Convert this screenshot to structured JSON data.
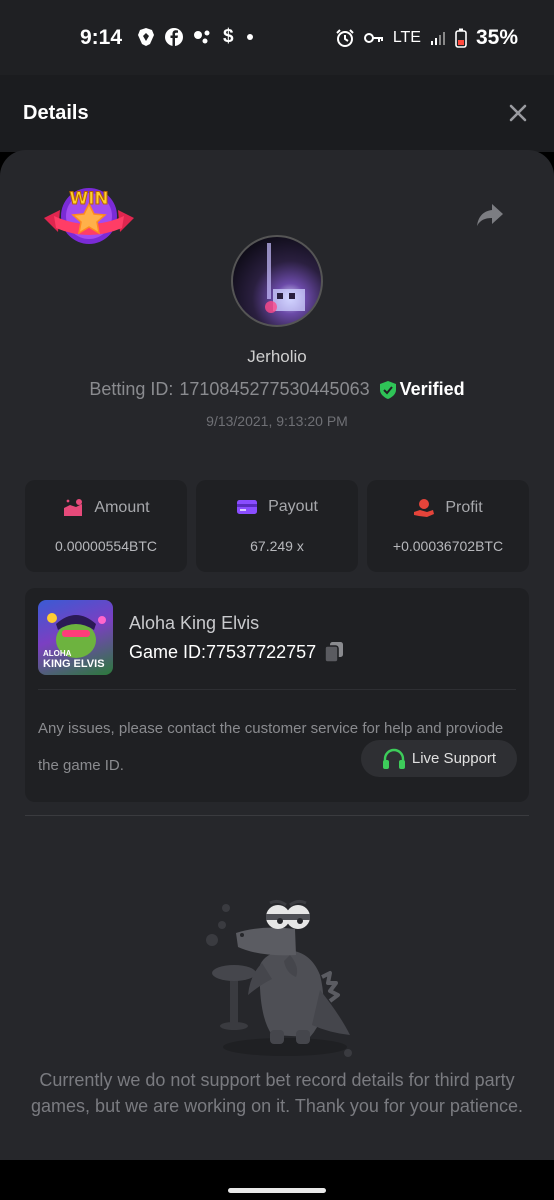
{
  "status_bar": {
    "time": "9:14",
    "network": "LTE",
    "battery": "35%",
    "dollar": "$"
  },
  "header": {
    "title": "Details"
  },
  "profile": {
    "username": "Jerholio",
    "betting_id_label": "Betting ID:",
    "betting_id": "1710845277530445063",
    "verified_label": "Verified",
    "timestamp": "9/13/2021, 9:13:20 PM"
  },
  "badge": {
    "text": "WIN"
  },
  "stats": [
    {
      "label": "Amount",
      "value": "0.00000554BTC"
    },
    {
      "label": "Payout",
      "value": "67.249 x"
    },
    {
      "label": "Profit",
      "value": "+0.00036702BTC"
    }
  ],
  "game": {
    "name": "Aloha King Elvis",
    "game_id_label": "Game ID:",
    "game_id": "77537722757",
    "thumb_title_1": "ALOHA",
    "thumb_title_2": "KING ELVIS",
    "issue_text": "Any issues, please contact the customer service for help and proviode the game ID.",
    "live_support_label": "Live Support"
  },
  "notice": "Currently we do not support bet record details for third party games, but we are working on it. Thank you for your patience.",
  "colors": {
    "verified": "#2fc357",
    "amount_icon": "#e64a7a",
    "payout_icon": "#8a4dff",
    "profit_icon": "#e5443a",
    "support_icon": "#3dcc5a"
  }
}
